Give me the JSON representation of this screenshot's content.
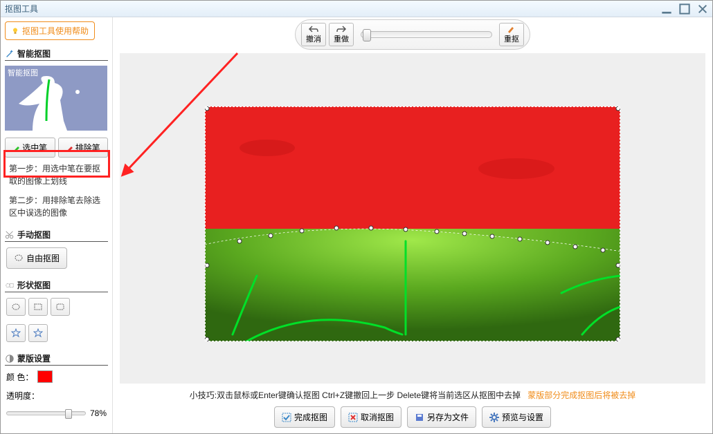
{
  "window": {
    "title": "抠图工具"
  },
  "sidebar": {
    "help_button": "抠图工具使用帮助",
    "smart_cutout": {
      "title": "智能抠图",
      "thumb_caption": "智能抠图"
    },
    "select_pen": "选中笔",
    "exclude_pen": "排除笔",
    "step1": "第一步：用选中笔在要抠取的图像上划线",
    "step2": "第二步：用排除笔去除选区中误选的图像",
    "manual_cutout": {
      "title": "手动抠图",
      "free_button": "自由抠图"
    },
    "shape_cutout": {
      "title": "形状抠图"
    },
    "mask": {
      "title": "蒙版设置",
      "color_label": "颜 色：",
      "opacity_label": "透明度：",
      "opacity_value": "78%",
      "color": "#ff0000"
    }
  },
  "toolbar": {
    "undo": "撤消",
    "redo": "重做",
    "recut": "重抠"
  },
  "hint": {
    "main": "小技巧:双击鼠标或Enter键确认抠图   Ctrl+Z键撤回上一步   Delete键将当前选区从抠图中去掉",
    "orange": "蒙版部分完成抠图后将被去掉"
  },
  "actions": {
    "finish": "完成抠图",
    "cancel": "取消抠图",
    "save_as": "另存为文件",
    "preview": "预览与设置"
  }
}
